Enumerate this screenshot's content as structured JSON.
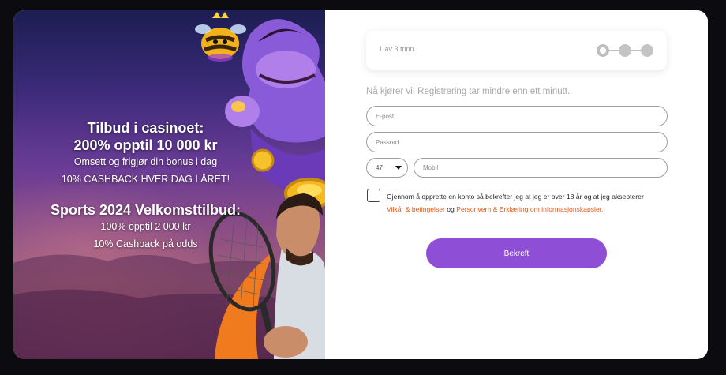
{
  "promo": {
    "casino_title": "Tilbud i casinoet:",
    "casino_offer": "200% opptil 10 000 kr",
    "casino_desc": "Omsett og frigjør din bonus i dag",
    "casino_cashback": "10% CASHBACK HVER DAG I ÅRET!",
    "sports_title": "Sports 2024 Velkomsttilbud:",
    "sports_offer": "100% opptil 2 000 kr",
    "sports_cashback": "10% Cashback på odds"
  },
  "stepper": {
    "label": "1 av 3 trinn",
    "current_step": 1,
    "total_steps": 3
  },
  "form": {
    "intro": "Nå kjører vi! Registrering tar mindre enn ett minutt.",
    "email_placeholder": "E-post",
    "password_placeholder": "Passord",
    "country_code": "47",
    "mobile_placeholder": "Mobil",
    "terms_text": "Gjennom å opprette en konto så bekrefter jeg at jeg er over 18 år og at jeg aksepterer",
    "terms_link": "Vilkår & betingelser",
    "terms_joiner": "og",
    "privacy_link": "Personvern & Erklæring om informasjonskapsler.",
    "submit_label": "Bekreft"
  },
  "colors": {
    "accent": "#8e4fd6",
    "link": "#e05a1a"
  },
  "icons": [
    "bee-mascot-image",
    "genie-image",
    "tennis-player-image",
    "caret-down-icon"
  ]
}
